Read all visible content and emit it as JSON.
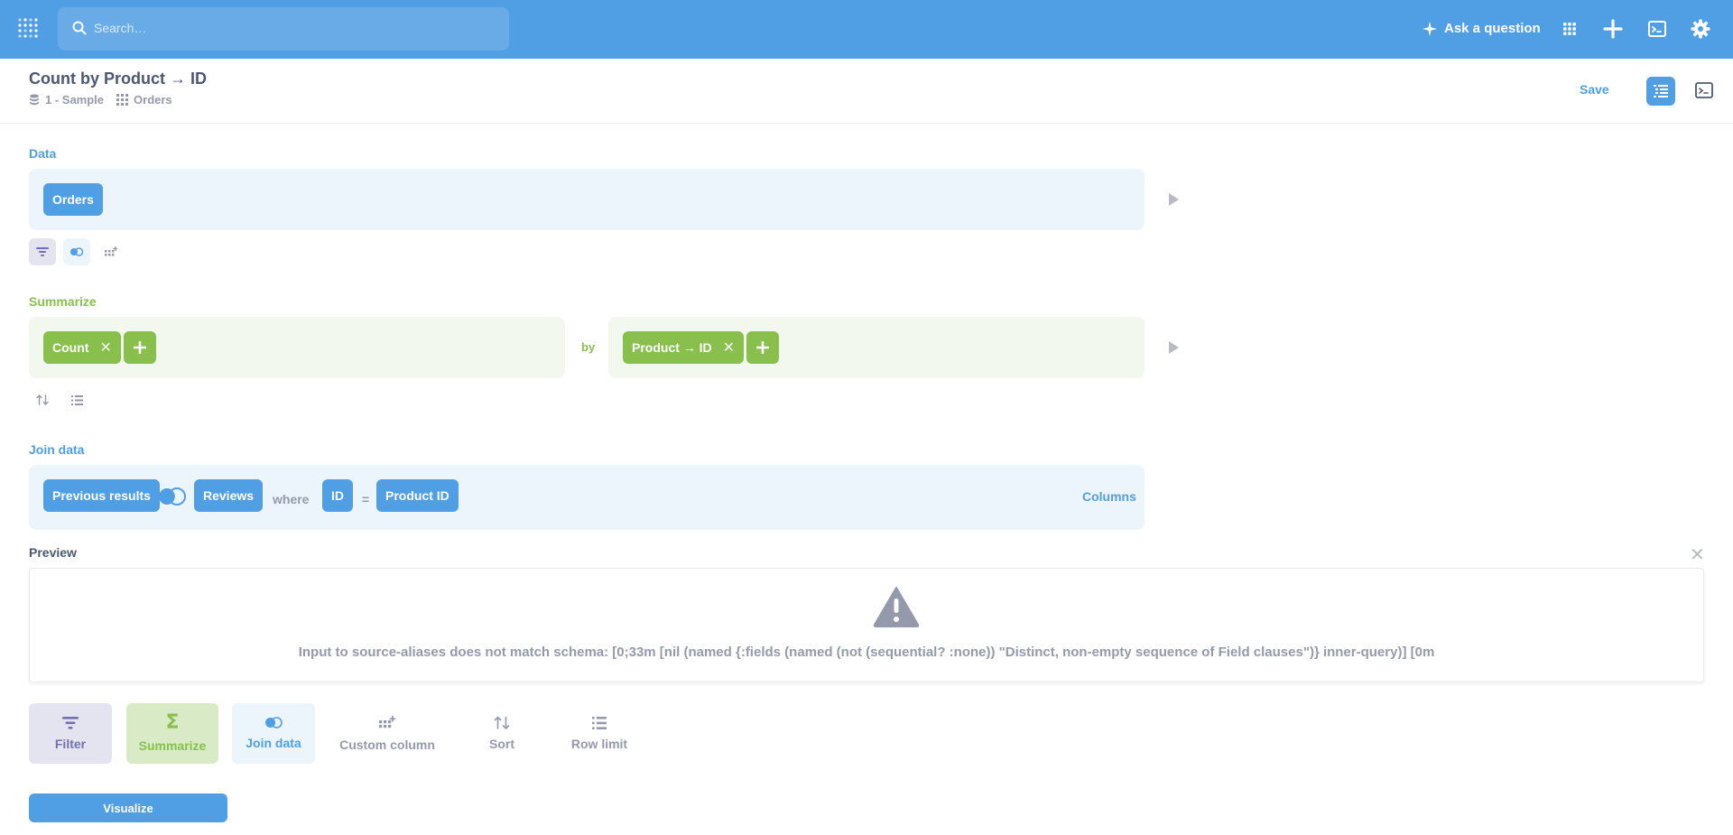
{
  "nav": {
    "search_placeholder": "Search…",
    "ask_label": "Ask a question",
    "icons": [
      "metabase-logo-icon",
      "search-icon",
      "sparkle-icon",
      "grid-icon",
      "plus-icon",
      "sql-editor-icon",
      "gear-icon"
    ]
  },
  "header": {
    "title": "Count by Product → ID",
    "database": "1 - Sample",
    "table": "Orders",
    "save_label": "Save"
  },
  "data_step": {
    "label": "Data",
    "table_pill": "Orders"
  },
  "summarize_step": {
    "label": "Summarize",
    "metric_pill": "Count",
    "by_label": "by",
    "breakout_pill": "Product → ID"
  },
  "join_step": {
    "label": "Join data",
    "left_table": "Previous results",
    "right_table": "Reviews",
    "where_label": "where",
    "left_column": "ID",
    "equals": "=",
    "right_column": "Product ID",
    "columns_label": "Columns"
  },
  "preview": {
    "label": "Preview",
    "error": "Input to source-aliases does not match schema: [0;33m [nil (named {:fields (named (not (sequential? :none)) \"Distinct, non-empty sequence of Field clauses\")} inner-query)] [0m"
  },
  "actions": {
    "filter": "Filter",
    "summarize": "Summarize",
    "join": "Join data",
    "custom_column": "Custom column",
    "sort": "Sort",
    "row_limit": "Row limit"
  },
  "visualize_label": "Visualize",
  "colors": {
    "brand": "#509ee3",
    "summarize": "#88bf4d",
    "filter": "#7172ad",
    "text": "#4c5773",
    "muted": "#949aab"
  }
}
